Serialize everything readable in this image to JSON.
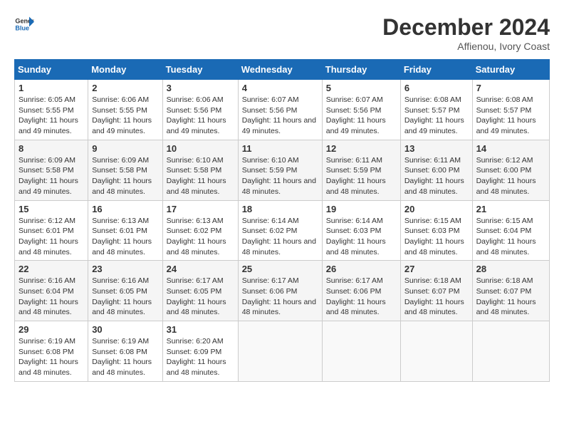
{
  "header": {
    "logo_general": "General",
    "logo_blue": "Blue",
    "title": "December 2024",
    "subtitle": "Affienou, Ivory Coast"
  },
  "calendar": {
    "weekdays": [
      "Sunday",
      "Monday",
      "Tuesday",
      "Wednesday",
      "Thursday",
      "Friday",
      "Saturday"
    ],
    "weeks": [
      [
        {
          "day": "1",
          "sunrise": "6:05 AM",
          "sunset": "5:55 PM",
          "daylight": "11 hours and 49 minutes."
        },
        {
          "day": "2",
          "sunrise": "6:06 AM",
          "sunset": "5:55 PM",
          "daylight": "11 hours and 49 minutes."
        },
        {
          "day": "3",
          "sunrise": "6:06 AM",
          "sunset": "5:56 PM",
          "daylight": "11 hours and 49 minutes."
        },
        {
          "day": "4",
          "sunrise": "6:07 AM",
          "sunset": "5:56 PM",
          "daylight": "11 hours and 49 minutes."
        },
        {
          "day": "5",
          "sunrise": "6:07 AM",
          "sunset": "5:56 PM",
          "daylight": "11 hours and 49 minutes."
        },
        {
          "day": "6",
          "sunrise": "6:08 AM",
          "sunset": "5:57 PM",
          "daylight": "11 hours and 49 minutes."
        },
        {
          "day": "7",
          "sunrise": "6:08 AM",
          "sunset": "5:57 PM",
          "daylight": "11 hours and 49 minutes."
        }
      ],
      [
        {
          "day": "8",
          "sunrise": "6:09 AM",
          "sunset": "5:58 PM",
          "daylight": "11 hours and 49 minutes."
        },
        {
          "day": "9",
          "sunrise": "6:09 AM",
          "sunset": "5:58 PM",
          "daylight": "11 hours and 48 minutes."
        },
        {
          "day": "10",
          "sunrise": "6:10 AM",
          "sunset": "5:58 PM",
          "daylight": "11 hours and 48 minutes."
        },
        {
          "day": "11",
          "sunrise": "6:10 AM",
          "sunset": "5:59 PM",
          "daylight": "11 hours and 48 minutes."
        },
        {
          "day": "12",
          "sunrise": "6:11 AM",
          "sunset": "5:59 PM",
          "daylight": "11 hours and 48 minutes."
        },
        {
          "day": "13",
          "sunrise": "6:11 AM",
          "sunset": "6:00 PM",
          "daylight": "11 hours and 48 minutes."
        },
        {
          "day": "14",
          "sunrise": "6:12 AM",
          "sunset": "6:00 PM",
          "daylight": "11 hours and 48 minutes."
        }
      ],
      [
        {
          "day": "15",
          "sunrise": "6:12 AM",
          "sunset": "6:01 PM",
          "daylight": "11 hours and 48 minutes."
        },
        {
          "day": "16",
          "sunrise": "6:13 AM",
          "sunset": "6:01 PM",
          "daylight": "11 hours and 48 minutes."
        },
        {
          "day": "17",
          "sunrise": "6:13 AM",
          "sunset": "6:02 PM",
          "daylight": "11 hours and 48 minutes."
        },
        {
          "day": "18",
          "sunrise": "6:14 AM",
          "sunset": "6:02 PM",
          "daylight": "11 hours and 48 minutes."
        },
        {
          "day": "19",
          "sunrise": "6:14 AM",
          "sunset": "6:03 PM",
          "daylight": "11 hours and 48 minutes."
        },
        {
          "day": "20",
          "sunrise": "6:15 AM",
          "sunset": "6:03 PM",
          "daylight": "11 hours and 48 minutes."
        },
        {
          "day": "21",
          "sunrise": "6:15 AM",
          "sunset": "6:04 PM",
          "daylight": "11 hours and 48 minutes."
        }
      ],
      [
        {
          "day": "22",
          "sunrise": "6:16 AM",
          "sunset": "6:04 PM",
          "daylight": "11 hours and 48 minutes."
        },
        {
          "day": "23",
          "sunrise": "6:16 AM",
          "sunset": "6:05 PM",
          "daylight": "11 hours and 48 minutes."
        },
        {
          "day": "24",
          "sunrise": "6:17 AM",
          "sunset": "6:05 PM",
          "daylight": "11 hours and 48 minutes."
        },
        {
          "day": "25",
          "sunrise": "6:17 AM",
          "sunset": "6:06 PM",
          "daylight": "11 hours and 48 minutes."
        },
        {
          "day": "26",
          "sunrise": "6:17 AM",
          "sunset": "6:06 PM",
          "daylight": "11 hours and 48 minutes."
        },
        {
          "day": "27",
          "sunrise": "6:18 AM",
          "sunset": "6:07 PM",
          "daylight": "11 hours and 48 minutes."
        },
        {
          "day": "28",
          "sunrise": "6:18 AM",
          "sunset": "6:07 PM",
          "daylight": "11 hours and 48 minutes."
        }
      ],
      [
        {
          "day": "29",
          "sunrise": "6:19 AM",
          "sunset": "6:08 PM",
          "daylight": "11 hours and 48 minutes."
        },
        {
          "day": "30",
          "sunrise": "6:19 AM",
          "sunset": "6:08 PM",
          "daylight": "11 hours and 48 minutes."
        },
        {
          "day": "31",
          "sunrise": "6:20 AM",
          "sunset": "6:09 PM",
          "daylight": "11 hours and 48 minutes."
        },
        null,
        null,
        null,
        null
      ]
    ]
  }
}
